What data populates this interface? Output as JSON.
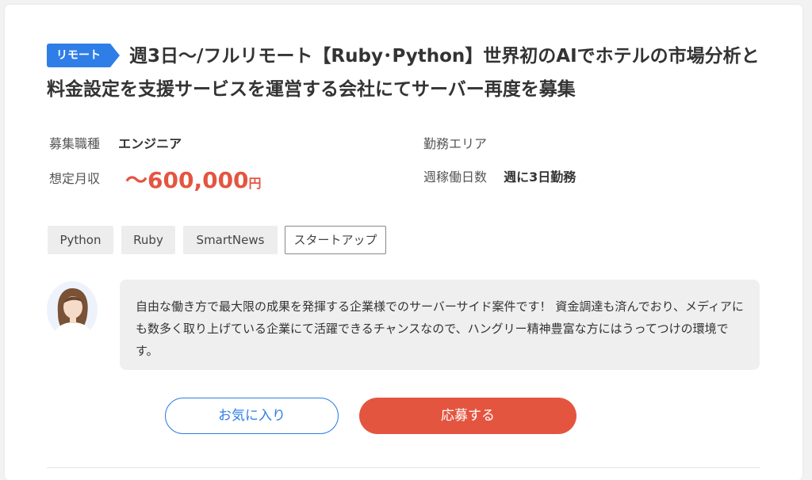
{
  "job": {
    "badge": "リモート",
    "title": "週3日〜/フルリモート【Ruby･Python】世界初のAIでホテルの市場分析と料金設定を支援サービスを運営する会社にてサーバー再度を募集"
  },
  "details": {
    "role_label": "募集職種",
    "role_value": "エンジニア",
    "salary_label": "想定月収",
    "salary_amount": "〜600,000",
    "salary_unit": "円",
    "area_label": "勤務エリア",
    "days_label": "週稼働日数",
    "days_value": "週に3日勤務"
  },
  "tags": [
    "Python",
    "Ruby",
    "SmartNews",
    "スタートアップ"
  ],
  "comment": {
    "text": "自由な働き方で最大限の成果を発揮する企業様でのサーバーサイド案件です！ 資金調達も済んでおり、メディアにも数多く取り上げている企業にて活躍できるチャンスなので、ハングリー精神豊富な方にはうってつけの環境です。"
  },
  "actions": {
    "favorite_label": "お気に入り",
    "apply_label": "応募する"
  },
  "colors": {
    "accent_blue": "#2f7ee8",
    "accent_red": "#e45540"
  }
}
